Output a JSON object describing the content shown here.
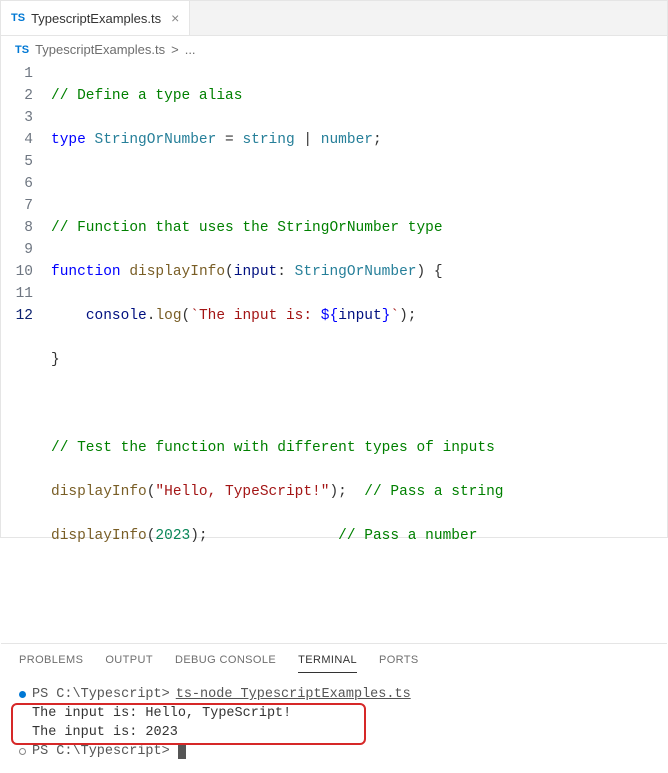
{
  "tab": {
    "icon_label": "TS",
    "filename": "TypescriptExamples.ts"
  },
  "breadcrumb": {
    "icon_label": "TS",
    "filename": "TypescriptExamples.ts",
    "sep": ">",
    "more": "..."
  },
  "code": {
    "l1": {
      "comment": "// Define a type alias"
    },
    "l2": {
      "kw_type": "type",
      "type_name": "StringOrNumber",
      "eq": " = ",
      "t1": "string",
      "pipe": " | ",
      "t2": "number",
      "semi": ";"
    },
    "l4": {
      "comment": "// Function that uses the StringOrNumber type"
    },
    "l5": {
      "kw_func": "function",
      "fname": "displayInfo",
      "lp": "(",
      "param": "input",
      "colon": ": ",
      "ptype": "StringOrNumber",
      "rp": ")",
      "brace": " {"
    },
    "l6": {
      "indent": "    ",
      "obj": "console",
      "dot": ".",
      "method": "log",
      "lp": "(",
      "tpl_open": "`",
      "tpl_text": "The input is: ",
      "interp_open": "${",
      "interp_var": "input",
      "interp_close": "}",
      "tpl_close": "`",
      "rp": ");"
    },
    "l7": {
      "brace": "}"
    },
    "l9": {
      "comment": "// Test the function with different types of inputs"
    },
    "l10": {
      "fname": "displayInfo",
      "lp": "(",
      "str": "\"Hello, TypeScript!\"",
      "rp": ");",
      "spacer": "  ",
      "comment": "// Pass a string"
    },
    "l11": {
      "fname": "displayInfo",
      "lp": "(",
      "num": "2023",
      "rp": ");",
      "spacer": "               ",
      "comment": "// Pass a number"
    }
  },
  "gutter": [
    "1",
    "2",
    "3",
    "4",
    "5",
    "6",
    "7",
    "8",
    "9",
    "10",
    "11",
    "12"
  ],
  "panel": {
    "tabs": {
      "problems": "PROBLEMS",
      "output": "OUTPUT",
      "debug": "DEBUG CONSOLE",
      "terminal": "TERMINAL",
      "ports": "PORTS"
    }
  },
  "terminal": {
    "l1": {
      "prompt": "PS C:\\Typescript>",
      "cmd": "ts-node TypescriptExamples.ts"
    },
    "l2": "The input is: Hello, TypeScript!",
    "l3": "The input is: 2023",
    "l4": {
      "prompt": "PS C:\\Typescript>"
    }
  }
}
